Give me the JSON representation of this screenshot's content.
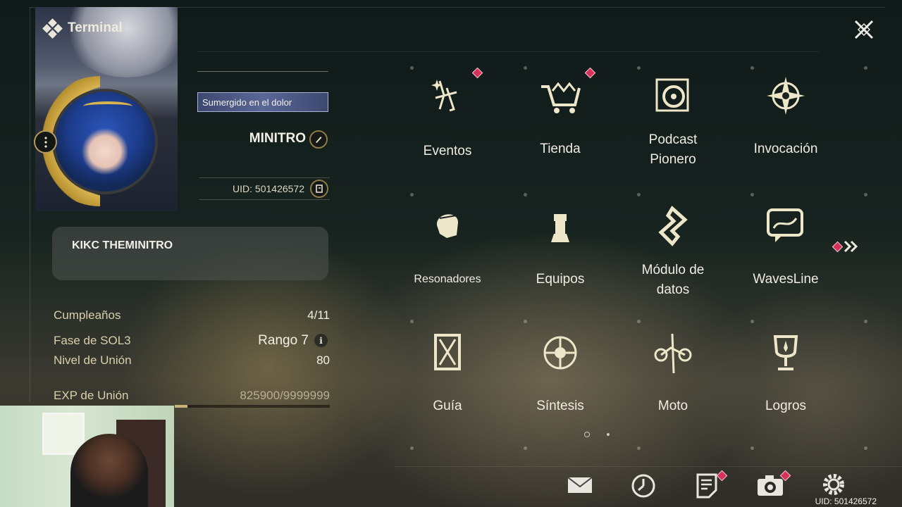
{
  "header": {
    "title": "Terminal"
  },
  "profile": {
    "title_badge": "Sumergido en el dolor",
    "username": "MINITRO",
    "uid": "UID: 501426572",
    "signature": "KIKC THEMINITRO"
  },
  "stats": [
    {
      "label": "Cumpleaños",
      "value": "4/11"
    },
    {
      "label": "Fase de SOL3",
      "value": "Rango 7"
    },
    {
      "label": "Nivel de Unión",
      "value": "80"
    },
    {
      "label": "EXP de Unión",
      "value": "825900/9999999"
    }
  ],
  "exp_progress": 0.0826,
  "menu": [
    {
      "label": "Eventos",
      "icon": "sparkle-icon",
      "badge": true
    },
    {
      "label": "Tienda",
      "icon": "shop-cart-icon",
      "badge": true
    },
    {
      "label": "Podcast\nPionero",
      "icon": "podcast-disc-icon",
      "badge": false
    },
    {
      "label": "Invocación",
      "icon": "compass-star-icon",
      "badge": false
    },
    {
      "label": "Resonadores",
      "icon": "character-head-icon",
      "badge": false
    },
    {
      "label": "Equipos",
      "icon": "chess-pieces-icon",
      "badge": false
    },
    {
      "label": "Módulo de\ndatos",
      "icon": "data-module-icon",
      "badge": false
    },
    {
      "label": "WavesLine",
      "icon": "chat-bubble-icon",
      "badge": false
    },
    {
      "label": "Guía",
      "icon": "guide-book-icon",
      "badge": false
    },
    {
      "label": "Síntesis",
      "icon": "synthesis-icon",
      "badge": false
    },
    {
      "label": "Moto",
      "icon": "motorbike-icon",
      "badge": false
    },
    {
      "label": "Logros",
      "icon": "trophy-icon",
      "badge": false
    }
  ],
  "pagination": {
    "current": 1,
    "total": 2
  },
  "bottom_bar": {
    "icons": [
      "mail-icon",
      "clock-icon",
      "notes-icon",
      "camera-icon",
      "settings-gear-icon"
    ],
    "uid": "UID: 501426572"
  },
  "colors": {
    "accent_gold": "#c7b27a",
    "badge_red": "#d5325a"
  }
}
